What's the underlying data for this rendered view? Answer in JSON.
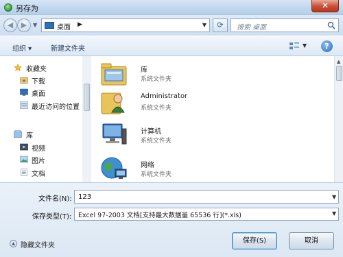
{
  "window": {
    "title": "另存为",
    "close_label": "✕"
  },
  "nav": {
    "back_glyph": "◀",
    "forward_glyph": "▶",
    "address": {
      "location": "桌面",
      "separator": "▶"
    },
    "search_placeholder": "搜索 桌面"
  },
  "toolbar": {
    "organize": "组织 ▾",
    "new_folder": "新建文件夹",
    "help": "?"
  },
  "sidebar": {
    "items": [
      {
        "label": "收藏夹",
        "icon": "star-icon"
      },
      {
        "label": "下载",
        "icon": "download-folder-icon"
      },
      {
        "label": "桌面",
        "icon": "desktop-icon"
      },
      {
        "label": "最近访问的位置",
        "icon": "recent-places-icon"
      },
      {
        "label": "库",
        "icon": "library-icon"
      },
      {
        "label": "视频",
        "icon": "video-icon"
      },
      {
        "label": "图片",
        "icon": "picture-icon"
      },
      {
        "label": "文档",
        "icon": "document-icon"
      }
    ]
  },
  "files": [
    {
      "name": "库",
      "type": "系统文件夹",
      "icon": "library-folder-icon"
    },
    {
      "name": "Administrator",
      "type": "系统文件夹",
      "icon": "user-folder-icon"
    },
    {
      "name": "计算机",
      "type": "系统文件夹",
      "icon": "computer-icon"
    },
    {
      "name": "网络",
      "type": "系统文件夹",
      "icon": "network-icon"
    }
  ],
  "form": {
    "filename_label": "文件名(N):",
    "filename_value": "123",
    "filetype_label": "保存类型(T):",
    "filetype_value": "Excel 97-2003 文档[支持最大数据量 65536 行](*.xls)"
  },
  "footer": {
    "hide_folders": "隐藏文件夹",
    "save": "保存(S)",
    "cancel": "取消"
  }
}
